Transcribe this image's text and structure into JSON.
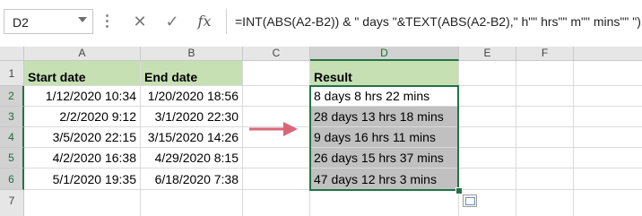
{
  "formula_bar": {
    "name_box": "D2",
    "cancel_glyph": "✕",
    "enter_glyph": "✓",
    "fx_label": "fx",
    "formula": "=INT(ABS(A2-B2)) & \" days \"&TEXT(ABS(A2-B2),\" h\"\" hrs\"\" m\"\" mins\"\" \")"
  },
  "columns": [
    "A",
    "B",
    "C",
    "D",
    "E",
    "F"
  ],
  "rows": [
    "1",
    "2",
    "3",
    "4",
    "5",
    "6",
    "7"
  ],
  "cells": {
    "A1": "Start date",
    "B1": "End date",
    "D1": "Result",
    "A": [
      "1/12/2020 10:34",
      "2/2/2020 9:12",
      "3/5/2020 22:15",
      "4/2/2020 16:38",
      "5/1/2020 19:35"
    ],
    "B": [
      "1/20/2020 18:56",
      "3/1/2020 22:30",
      "3/15/2020 14:26",
      "4/29/2020 8:15",
      "6/18/2020 7:38"
    ],
    "D": [
      "8 days  8 hrs 22 mins",
      "28 days  13 hrs 18 mins",
      "9 days  16 hrs 11 mins",
      "26 days  15 hrs 37 mins",
      "47 days  12 hrs 3 mins"
    ]
  },
  "colors": {
    "header_fill": "#c6e0b4",
    "result_fill": "#c0c0c0",
    "selection": "#217346",
    "arrow": "#d9677a"
  },
  "icons": {
    "name_box_dropdown": "chevron-down-icon",
    "quick_analysis": "quick-analysis-icon",
    "arrow": "right-arrow-icon"
  }
}
